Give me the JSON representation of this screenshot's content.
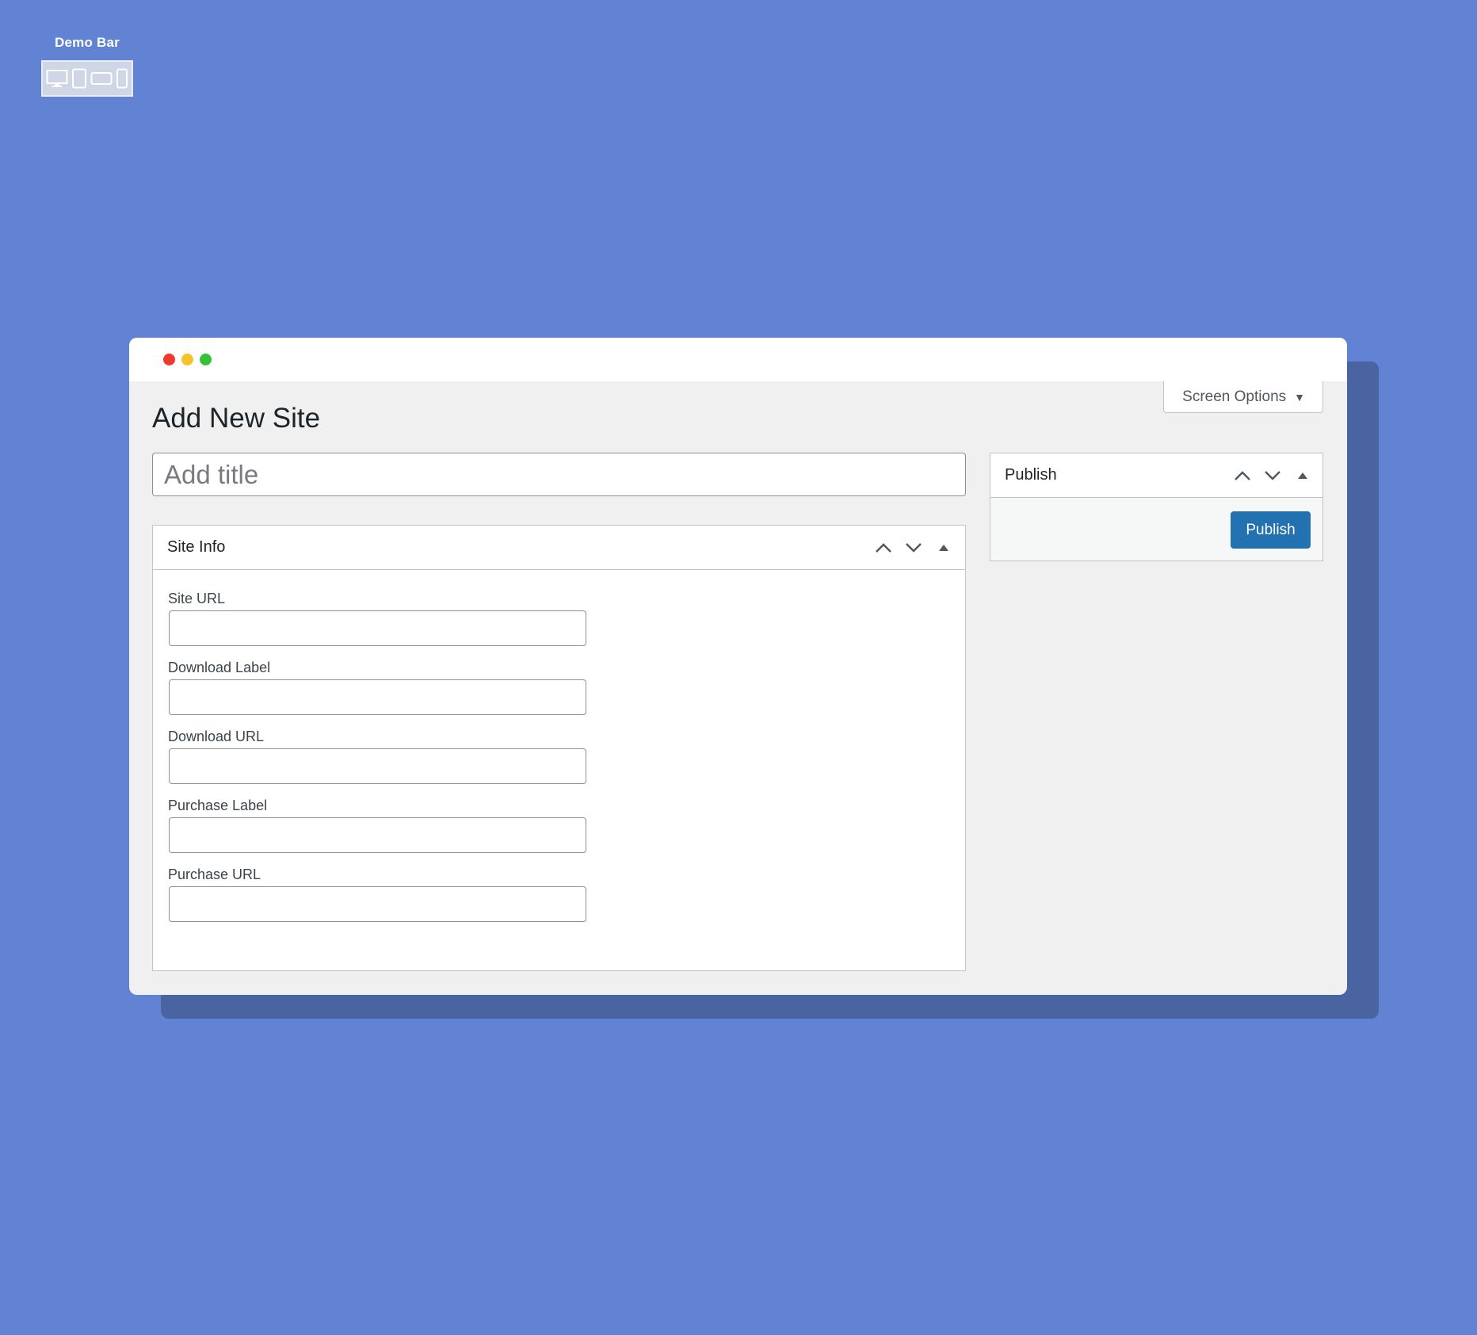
{
  "demo_bar": {
    "title": "Demo Bar",
    "devices": [
      "desktop-icon",
      "tablet-portrait-icon",
      "tablet-landscape-icon",
      "mobile-icon"
    ]
  },
  "window": {
    "screen_options_label": "Screen Options",
    "page_title": "Add New Site",
    "title_placeholder": "Add title",
    "site_info": {
      "title": "Site Info",
      "fields": [
        {
          "label": "Site URL",
          "value": ""
        },
        {
          "label": "Download Label",
          "value": ""
        },
        {
          "label": "Download URL",
          "value": ""
        },
        {
          "label": "Purchase Label",
          "value": ""
        },
        {
          "label": "Purchase URL",
          "value": ""
        }
      ]
    },
    "publish": {
      "title": "Publish",
      "button_label": "Publish"
    }
  },
  "colors": {
    "background": "#6283d4",
    "window_shadow": "#4a64a2",
    "primary_button": "#2271b1",
    "traffic_red": "#ee3a2c",
    "traffic_yellow": "#f5c22b",
    "traffic_green": "#35c13b"
  }
}
